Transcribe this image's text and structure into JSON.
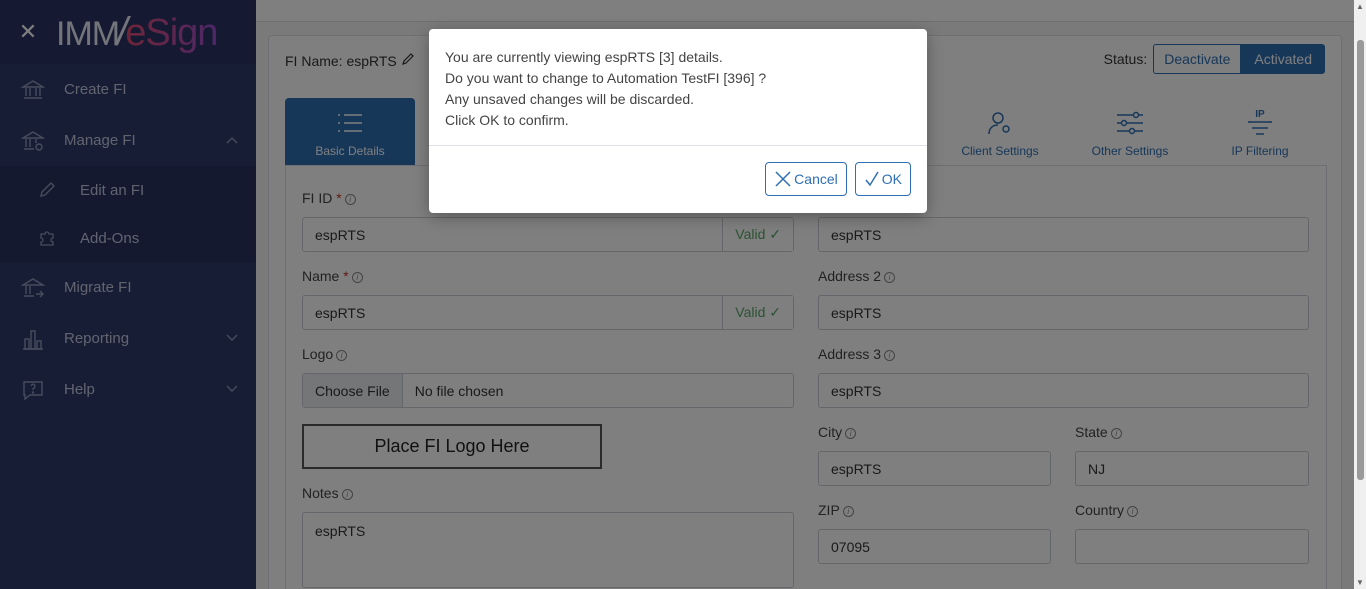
{
  "sidebar": {
    "logo_left": "IMM",
    "logo_slash": "/",
    "logo_right": "eSign",
    "items": [
      {
        "label": "Create FI"
      },
      {
        "label": "Manage FI"
      },
      {
        "label": "Edit an FI"
      },
      {
        "label": "Add-Ons"
      },
      {
        "label": "Migrate FI"
      },
      {
        "label": "Reporting"
      },
      {
        "label": "Help"
      }
    ]
  },
  "header": {
    "fi_name": "FI Name: espRTS",
    "status_label": "Status:",
    "deactivate_label": "Deactivate",
    "activated_label": "Activated"
  },
  "tabs": [
    {
      "label": "Basic Details"
    },
    {
      "label": "Client Settings"
    },
    {
      "label": "Other Settings"
    },
    {
      "label": "IP Filtering",
      "icon_text": "IP"
    }
  ],
  "form": {
    "fi_id_label": "FI ID",
    "fi_id_value": "espRTS",
    "name_label": "Name",
    "name_value": "espRTS",
    "valid_label": "Valid ✓",
    "logo_label": "Logo",
    "choose_file": "Choose File",
    "no_file": "No file chosen",
    "logo_placeholder": "Place FI Logo Here",
    "notes_label": "Notes",
    "notes_value": "espRTS",
    "address1_value": "espRTS",
    "address2_label": "Address 2",
    "address2_value": "espRTS",
    "address3_label": "Address 3",
    "address3_value": "espRTS",
    "city_label": "City",
    "city_value": "espRTS",
    "state_label": "State",
    "state_value": "NJ",
    "zip_label": "ZIP",
    "zip_value": "07095",
    "country_label": "Country",
    "country_value": "",
    "required_mark": "*",
    "info_mark": "i"
  },
  "modal": {
    "line1": "You are currently viewing espRTS [3] details.",
    "line2": "Do you want to change to Automation TestFI [396] ?",
    "line3": "Any unsaved changes will be discarded.",
    "line4": "Click OK to confirm.",
    "cancel_label": "Cancel",
    "ok_label": "OK"
  }
}
